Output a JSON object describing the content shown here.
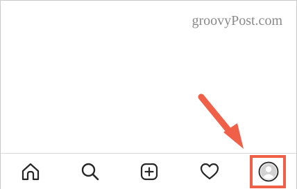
{
  "watermark": {
    "text": "groovyPost.com"
  },
  "bottom_nav": {
    "items": [
      {
        "id": "home",
        "icon": "home-icon"
      },
      {
        "id": "search",
        "icon": "search-icon"
      },
      {
        "id": "create",
        "icon": "add-post-icon"
      },
      {
        "id": "activity",
        "icon": "heart-icon"
      },
      {
        "id": "profile",
        "icon": "profile-avatar-icon"
      }
    ]
  },
  "annotation": {
    "arrow_color": "#f06048",
    "highlight_color": "#f06048",
    "target": "profile"
  }
}
